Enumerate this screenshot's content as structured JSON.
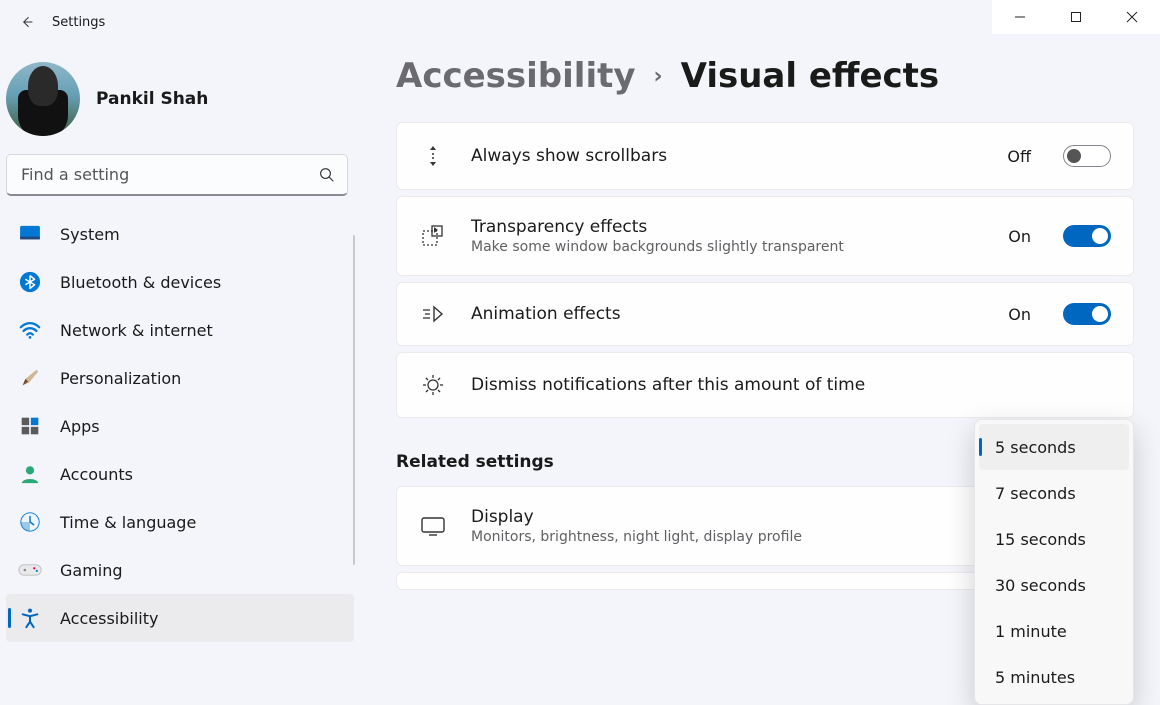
{
  "app": {
    "title": "Settings"
  },
  "user": {
    "name": "Pankil Shah"
  },
  "search": {
    "placeholder": "Find a setting"
  },
  "nav": {
    "items": [
      {
        "label": "System"
      },
      {
        "label": "Bluetooth & devices"
      },
      {
        "label": "Network & internet"
      },
      {
        "label": "Personalization"
      },
      {
        "label": "Apps"
      },
      {
        "label": "Accounts"
      },
      {
        "label": "Time & language"
      },
      {
        "label": "Gaming"
      },
      {
        "label": "Accessibility"
      }
    ]
  },
  "breadcrumb": {
    "parent": "Accessibility",
    "current": "Visual effects"
  },
  "settings": {
    "scrollbars": {
      "title": "Always show scrollbars",
      "state_label": "Off",
      "on": false
    },
    "transparency": {
      "title": "Transparency effects",
      "sub": "Make some window backgrounds slightly transparent",
      "state_label": "On",
      "on": true
    },
    "animation": {
      "title": "Animation effects",
      "state_label": "On",
      "on": true
    },
    "dismiss": {
      "title": "Dismiss notifications after this amount of time"
    }
  },
  "related": {
    "heading": "Related settings",
    "display": {
      "title": "Display",
      "sub": "Monitors, brightness, night light, display profile"
    }
  },
  "dropdown": {
    "options": [
      {
        "label": "5 seconds",
        "selected": true
      },
      {
        "label": "7 seconds"
      },
      {
        "label": "15 seconds"
      },
      {
        "label": "30 seconds"
      },
      {
        "label": "1 minute"
      },
      {
        "label": "5 minutes"
      }
    ]
  }
}
